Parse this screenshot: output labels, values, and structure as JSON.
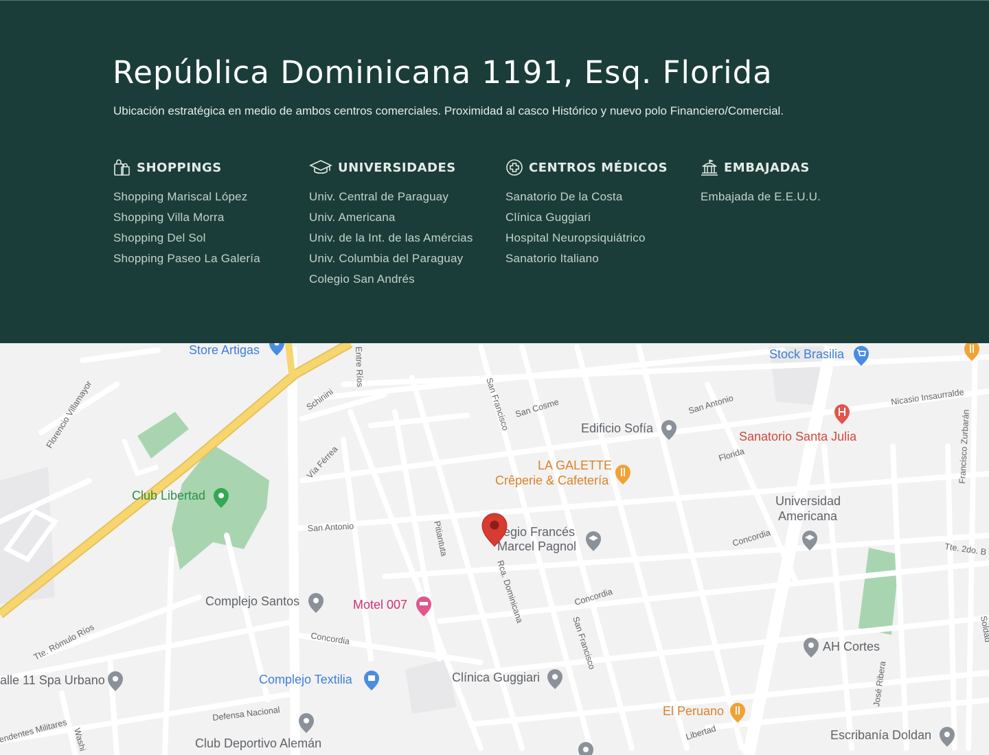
{
  "header": {
    "title": "República Dominicana 1191, Esq. Florida",
    "subtitle": "Ubicación estratégica en medio de ambos centros comerciales. Proximidad al casco Histórico y nuevo polo Financiero/Comercial."
  },
  "categories": [
    {
      "title": "SHOPPINGS",
      "icon": "shopping-bags-icon",
      "items": [
        "Shopping Mariscal López",
        "Shopping Villa Morra",
        "Shopping Del Sol",
        "Shopping Paseo La Galería"
      ]
    },
    {
      "title": "UNIVERSIDADES",
      "icon": "graduation-cap-icon",
      "items": [
        "Univ. Central de Paraguay",
        "Univ. Americana",
        "Univ. de la Int. de las Amércias",
        "Univ. Columbia del Paraguay",
        "Colegio San Andrés"
      ]
    },
    {
      "title": "CENTROS MÉDICOS",
      "icon": "medical-cross-icon",
      "items": [
        "Sanatorio De la Costa",
        "Clínica Guggiari",
        "Hospital Neuropsiquiátrico",
        "Sanatorio Italiano"
      ]
    },
    {
      "title": "EMBAJADAS",
      "icon": "embassy-building-icon",
      "items": [
        "Embajada de E.E.U.U."
      ]
    }
  ],
  "map": {
    "places": {
      "store_artigas": "Store Artigas",
      "stock_brasilia": "Stock Brasilia",
      "edificio_sofia": "Edificio Sofía",
      "sanatorio_santa_julia": "Sanatorio Santa Julia",
      "la_galette_1": "LA GALETTE",
      "la_galette_2": "Crêperie & Cafetería",
      "club_libertad": "Club Libertad",
      "universidad_americana_1": "Universidad",
      "universidad_americana_2": "Americana",
      "colegio_frances_1": "legio Francés",
      "colegio_frances_2": "Marcel Pagnol",
      "complejo_santos": "Complejo Santos",
      "motel_007": "Motel 007",
      "ah_cortes": "AH Cortes",
      "spa_urbano": "alle 11 Spa Urbano",
      "complejo_textilia": "Complejo Textilia",
      "clinica_guggiari": "Clínica Guggiari",
      "el_peruano": "El Peruano",
      "club_aleman": "Club Deportivo Alemán",
      "escribania_doldan": "Escribanía Doldan"
    },
    "streets": {
      "entre_rios": "Entre Ríos",
      "san_francisco_n": "San Francisco",
      "san_cosme": "San Cosme",
      "san_antonio_ne": "San Antonio",
      "nicasio": "Nicasio Insaurralde",
      "francisco_zurbaran": "Francisco Zurbarán",
      "florencio": "Florencio Villamayor",
      "schinini": "Schinini",
      "via_ferrea": "Vía Férrea",
      "florida": "Florida",
      "san_antonio_w": "San Antonio",
      "pitiantuta": "Pitiantuta",
      "concordia_e": "Concordia",
      "tte_2do": "Tte. 2do. B",
      "rca_dominicana": "Rca. Dominicana",
      "concordia_c": "Concordia",
      "san_francisco_s": "San Francisco",
      "tte_romulo": "Tte. Rómulo Ríos",
      "concordia_w": "Concordia",
      "jose_ribera": "José Ribera",
      "defensa": "Defensa Nacional",
      "liberdad": "Libertad",
      "militares": "endentes Militares",
      "washi": "Washi",
      "soldad": "Soldad"
    },
    "colors": {
      "road": "#ffffff",
      "highway": "#f7d66f",
      "park": "#a8d5b0",
      "land": "#f2f2f2",
      "pin": "#d93a32"
    }
  }
}
